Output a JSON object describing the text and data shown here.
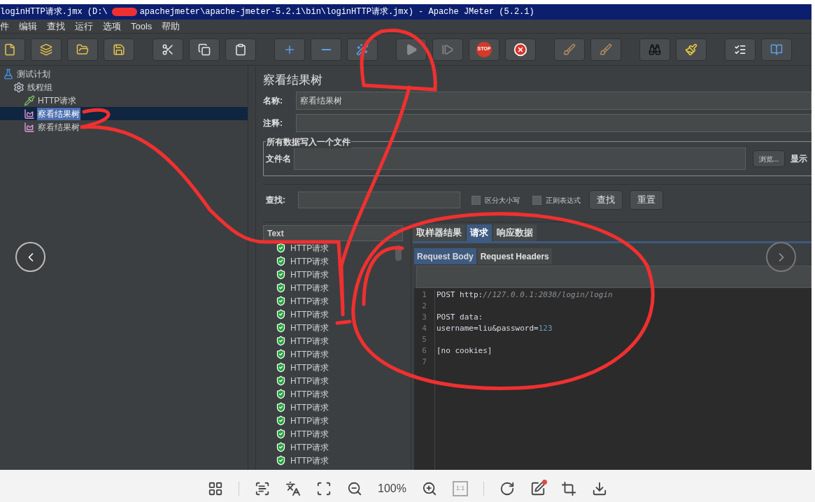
{
  "window": {
    "title_parts": [
      "loginHTTP请求.jmx (D:\\",
      "apachejmeter\\apache-jmeter-5.2.1\\bin\\loginHTTP请求.jmx) - Apache JMeter (5.2.1)"
    ]
  },
  "menu": [
    "件",
    "编辑",
    "查找",
    "运行",
    "选项",
    "Tools",
    "帮助"
  ],
  "toolbar": {
    "stop_text": "STOP"
  },
  "tree": [
    {
      "label": "测试计划",
      "kind": "plan",
      "selected": false,
      "children": [
        {
          "label": "线程组",
          "kind": "threads",
          "selected": false,
          "children": [
            {
              "label": "HTTP请求",
              "kind": "sampler",
              "selected": false
            },
            {
              "label": "察看结果树",
              "kind": "listener",
              "selected": true
            },
            {
              "label": "察看结果树",
              "kind": "listener",
              "selected": false
            }
          ]
        }
      ]
    }
  ],
  "panel": {
    "title": "察看结果树",
    "name_label": "名称:",
    "name_value": "察看结果树",
    "comment_label": "注释:",
    "file_group": "所有数据写入一个文件",
    "file_label": "文件名",
    "browse": "浏览...",
    "display_cut": "显示",
    "search_label": "查找:",
    "case_label": "区分大小写",
    "case_checked": false,
    "regex_label": "正则表达式",
    "regex_checked": false,
    "find_button": "查找",
    "reset_button": "重置"
  },
  "results": {
    "renderer": "Text",
    "samples": [
      "HTTP请求",
      "HTTP请求",
      "HTTP请求",
      "HTTP请求",
      "HTTP请求",
      "HTTP请求",
      "HTTP请求",
      "HTTP请求",
      "HTTP请求",
      "HTTP请求",
      "HTTP请求",
      "HTTP请求",
      "HTTP请求",
      "HTTP请求",
      "HTTP请求",
      "HTTP请求",
      "HTTP请求"
    ],
    "tabs": [
      {
        "label": "取样器结果",
        "selected": false
      },
      {
        "label": "请求",
        "selected": true
      },
      {
        "label": "响应数据",
        "selected": false
      }
    ],
    "subtabs": [
      {
        "label": "Request Body",
        "selected": true
      },
      {
        "label": "Request Headers",
        "selected": false
      }
    ],
    "lines": [
      {
        "number": "1",
        "segments": [
          {
            "kind": "plain",
            "text": "POST http:"
          },
          {
            "kind": "comment",
            "text": "//127.0.0.1:2038/login/login"
          }
        ]
      },
      {
        "number": "2"
      },
      {
        "number": "3",
        "segments": [
          {
            "kind": "plain",
            "text": "POST data:"
          }
        ]
      },
      {
        "number": "4",
        "segments": [
          {
            "kind": "plain",
            "text": "username=liu&password="
          },
          {
            "kind": "number",
            "text": "123"
          }
        ]
      },
      {
        "number": "5"
      },
      {
        "number": "6",
        "segments": [
          {
            "kind": "plain",
            "text": "[no cookies]"
          }
        ]
      },
      {
        "number": "7"
      }
    ]
  },
  "viewer": {
    "zoom": "100%",
    "actual_size": "1:1"
  }
}
